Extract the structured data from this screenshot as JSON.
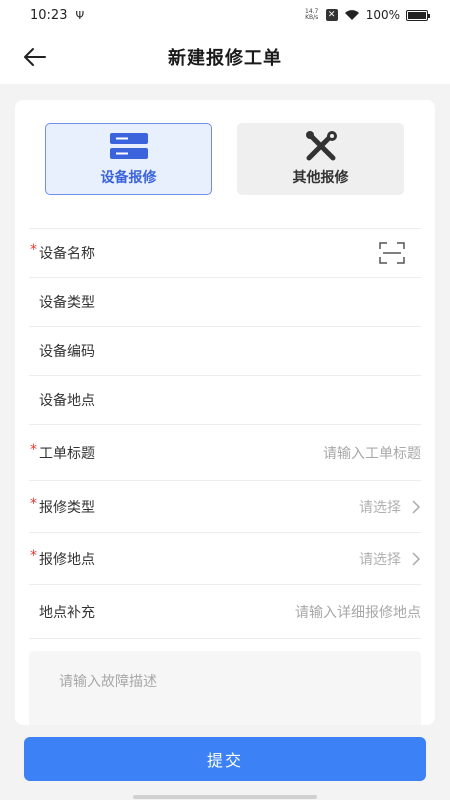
{
  "status_bar": {
    "time": "10:23",
    "usb_glyph": "Ψ",
    "net_speed_value": "14.7",
    "net_speed_unit": "KB/s",
    "x_glyph": "✕",
    "battery": "100%"
  },
  "header": {
    "title": "新建报修工单"
  },
  "tabs": [
    {
      "label": "设备报修",
      "icon": "server-icon",
      "selected": true
    },
    {
      "label": "其他报修",
      "icon": "tools-icon",
      "selected": false
    }
  ],
  "fields": {
    "device_name": {
      "required_mark": "*",
      "label": "设备名称"
    },
    "device_type": {
      "label": "设备类型"
    },
    "device_code": {
      "label": "设备编码"
    },
    "device_location": {
      "label": "设备地点"
    },
    "ticket_title": {
      "required_mark": "*",
      "label": "工单标题",
      "placeholder": "请输入工单标题"
    },
    "repair_type": {
      "required_mark": "*",
      "label": "报修类型",
      "placeholder": "请选择"
    },
    "repair_location": {
      "required_mark": "*",
      "label": "报修地点",
      "placeholder": "请选择"
    },
    "location_extra": {
      "label": "地点补充",
      "placeholder": "请输入详细报修地点"
    }
  },
  "fault": {
    "placeholder": "请输入故障描述"
  },
  "submit": {
    "label": "提交"
  },
  "colors": {
    "primary": "#3c82f6",
    "selected_tab_bg": "#e8effd",
    "selected_tab_text": "#3b64dc",
    "required": "#e53935"
  }
}
